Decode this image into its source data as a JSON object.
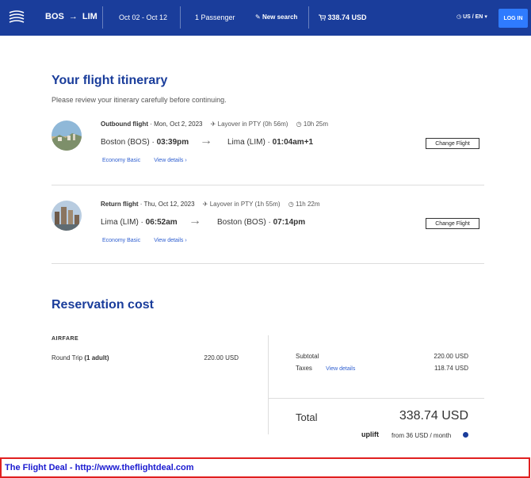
{
  "header": {
    "origin": "BOS",
    "destination": "LIM",
    "dates": "Oct 02 - Oct 12",
    "passengers": "1 Passenger",
    "new_search": "New search",
    "cart_total": "338.74 USD",
    "locale": "US / EN",
    "login": "LOG IN"
  },
  "itinerary": {
    "title": "Your flight itinerary",
    "subtitle": "Please review your itinerary carefully before continuing.",
    "flights": [
      {
        "heading_bold": "Outbound flight",
        "heading_date": " · Mon, Oct 2, 2023",
        "layover": "Layover in PTY (0h 56m)",
        "duration": "10h 25m",
        "dep_city": "Boston (BOS) · ",
        "dep_time": "03:39pm",
        "arr_city": "Lima (LIM) · ",
        "arr_time": "01:04am+1",
        "fare": "Economy Basic",
        "details": "View details",
        "change": "Change Flight"
      },
      {
        "heading_bold": "Return flight",
        "heading_date": " · Thu, Oct 12, 2023",
        "layover": "Layover in PTY (1h 55m)",
        "duration": "11h 22m",
        "dep_city": "Lima (LIM) · ",
        "dep_time": "06:52am",
        "arr_city": "Boston (BOS) · ",
        "arr_time": "07:14pm",
        "fare": "Economy Basic",
        "details": "View details",
        "change": "Change Flight"
      }
    ]
  },
  "reservation": {
    "title": "Reservation cost",
    "airfare_label": "AIRFARE",
    "round_trip_label": "Round Trip",
    "round_trip_qty": "(1 adult)",
    "round_trip_amount": "220.00 USD",
    "subtotal_label": "Subtotal",
    "subtotal_amount": "220.00 USD",
    "taxes_label": "Taxes",
    "taxes_link": "View details",
    "taxes_amount": "118.74 USD",
    "total_label": "Total",
    "total_amount": "338.74 USD",
    "uplift_brand": "uplift",
    "uplift_text": "from 36 USD  / month"
  },
  "footer": {
    "text": "The Flight Deal - http://www.theflightdeal.com"
  },
  "colors": {
    "header_bg": "#1a3d9b",
    "login_bg": "#2f7bff",
    "title": "#1a3d9b",
    "link": "#2f5fd0",
    "footer_border": "#e02020"
  }
}
